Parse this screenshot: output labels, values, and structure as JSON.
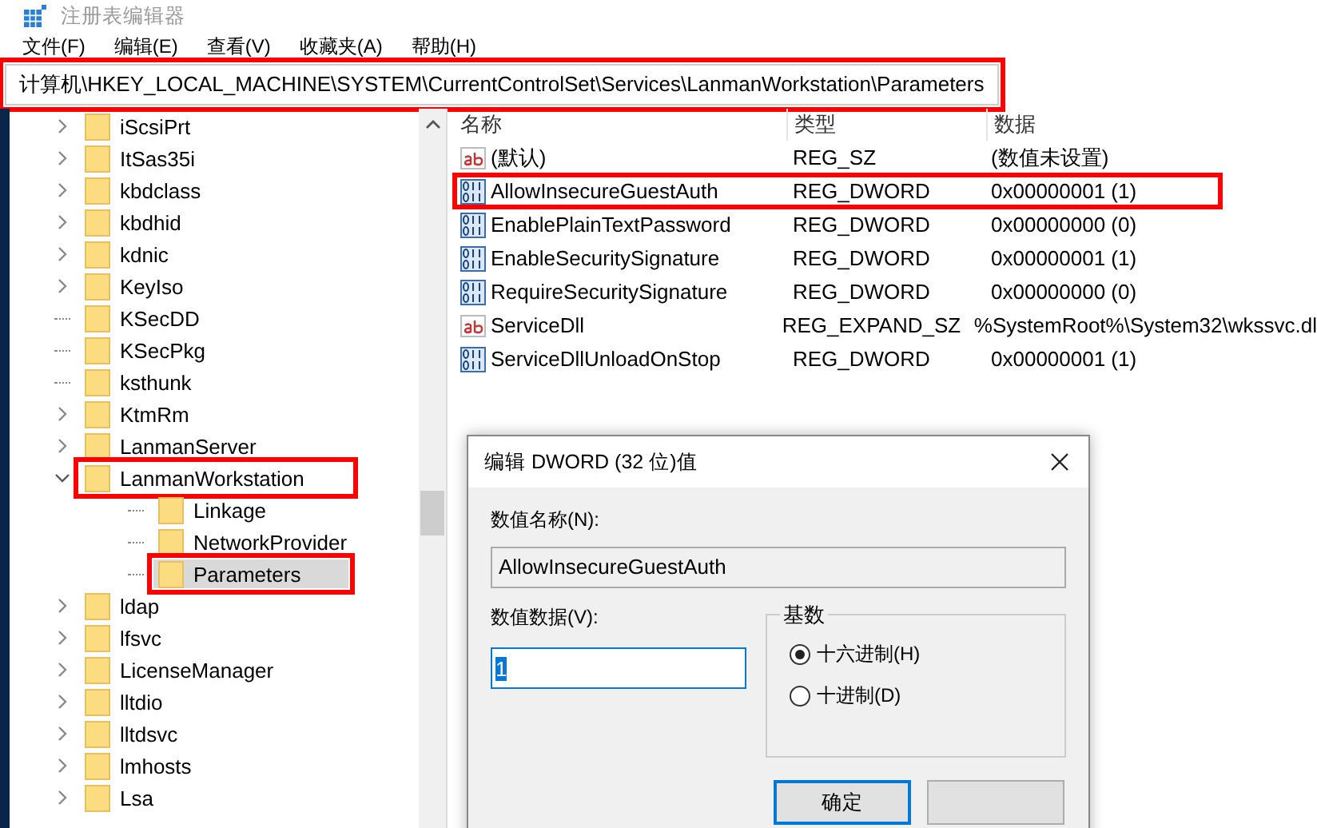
{
  "window": {
    "title": "注册表编辑器"
  },
  "menu": [
    "文件(F)",
    "编辑(E)",
    "查看(V)",
    "收藏夹(A)",
    "帮助(H)"
  ],
  "address_bar": {
    "value": "计算机\\HKEY_LOCAL_MACHINE\\SYSTEM\\CurrentControlSet\\Services\\LanmanWorkstation\\Parameters",
    "highlighted": true
  },
  "tree": [
    {
      "label": "iScsiPrt",
      "expanded": false,
      "selected": false,
      "highlighted": false
    },
    {
      "label": "ItSas35i",
      "expanded": false,
      "selected": false,
      "highlighted": false
    },
    {
      "label": "kbdclass",
      "expanded": false,
      "selected": false,
      "highlighted": false
    },
    {
      "label": "kbdhid",
      "expanded": false,
      "selected": false,
      "highlighted": false
    },
    {
      "label": "kdnic",
      "expanded": false,
      "selected": false,
      "highlighted": false
    },
    {
      "label": "KeyIso",
      "expanded": false,
      "selected": false,
      "highlighted": false
    },
    {
      "label": "KSecDD",
      "selected": false,
      "highlighted": false
    },
    {
      "label": "KSecPkg",
      "selected": false,
      "highlighted": false
    },
    {
      "label": "ksthunk",
      "selected": false,
      "highlighted": false
    },
    {
      "label": "KtmRm",
      "expanded": false,
      "selected": false,
      "highlighted": false
    },
    {
      "label": "LanmanServer",
      "expanded": false,
      "selected": false,
      "highlighted": false
    },
    {
      "label": "LanmanWorkstation",
      "expanded": true,
      "selected": false,
      "highlighted": true,
      "children": [
        {
          "label": "Linkage",
          "selected": false,
          "highlighted": false
        },
        {
          "label": "NetworkProvider",
          "selected": false,
          "highlighted": false
        },
        {
          "label": "Parameters",
          "selected": true,
          "highlighted": true
        }
      ]
    },
    {
      "label": "ldap",
      "expanded": false,
      "selected": false,
      "highlighted": false
    },
    {
      "label": "lfsvc",
      "expanded": false,
      "selected": false,
      "highlighted": false
    },
    {
      "label": "LicenseManager",
      "expanded": false,
      "selected": false,
      "highlighted": false
    },
    {
      "label": "lltdio",
      "expanded": false,
      "selected": false,
      "highlighted": false
    },
    {
      "label": "lltdsvc",
      "expanded": false,
      "selected": false,
      "highlighted": false
    },
    {
      "label": "lmhosts",
      "expanded": false,
      "selected": false,
      "highlighted": false
    },
    {
      "label": "Lsa",
      "expanded": false,
      "selected": false,
      "highlighted": false
    }
  ],
  "values": {
    "columns": [
      "名称",
      "类型",
      "数据"
    ],
    "rows": [
      {
        "kind": "string",
        "name": "(默认)",
        "type": "REG_SZ",
        "data": "(数值未设置)",
        "highlighted": false
      },
      {
        "kind": "binary",
        "name": "AllowInsecureGuestAuth",
        "type": "REG_DWORD",
        "data": "0x00000001 (1)",
        "highlighted": true
      },
      {
        "kind": "binary",
        "name": "EnablePlainTextPassword",
        "type": "REG_DWORD",
        "data": "0x00000000 (0)",
        "highlighted": false
      },
      {
        "kind": "binary",
        "name": "EnableSecuritySignature",
        "type": "REG_DWORD",
        "data": "0x00000001 (1)",
        "highlighted": false
      },
      {
        "kind": "binary",
        "name": "RequireSecuritySignature",
        "type": "REG_DWORD",
        "data": "0x00000000 (0)",
        "highlighted": false
      },
      {
        "kind": "string",
        "name": "ServiceDll",
        "type": "REG_EXPAND_SZ",
        "data": "%SystemRoot%\\System32\\wkssvc.dl",
        "highlighted": false
      },
      {
        "kind": "binary",
        "name": "ServiceDllUnloadOnStop",
        "type": "REG_DWORD",
        "data": "0x00000001 (1)",
        "highlighted": false
      }
    ]
  },
  "dialog": {
    "title": "编辑 DWORD (32 位)值",
    "name_label": "数值名称(N):",
    "name_value": "AllowInsecureGuestAuth",
    "data_label": "数值数据(V):",
    "data_value": "1",
    "base_label": "基数",
    "radios": [
      {
        "label": "十六进制(H)",
        "selected": true
      },
      {
        "label": "十进制(D)",
        "selected": false
      }
    ],
    "ok_button": "确定"
  }
}
